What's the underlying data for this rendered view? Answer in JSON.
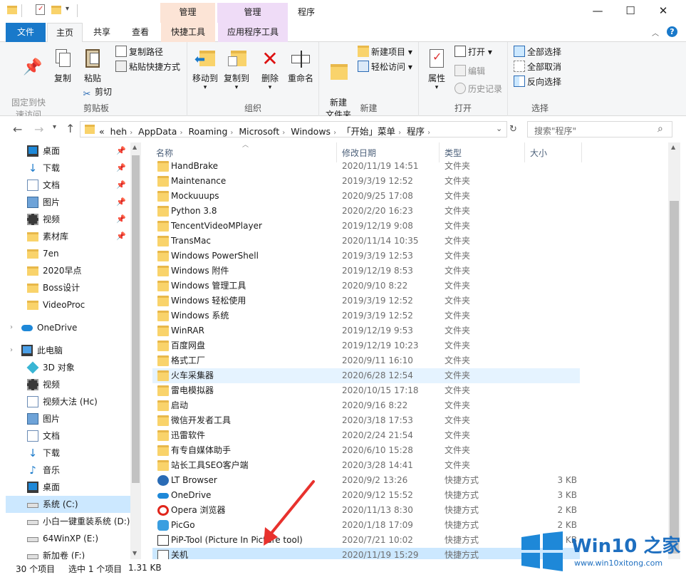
{
  "window": {
    "title": "程序",
    "contextual_tabs": [
      {
        "header": "管理",
        "tab": "快捷工具",
        "color": "#fce4d6"
      },
      {
        "header": "管理",
        "tab": "应用程序工具",
        "color": "#efdcf7"
      }
    ],
    "controls": {
      "minimize": "—",
      "maximize": "☐",
      "close": "✕"
    }
  },
  "tabs": {
    "file": "文件",
    "home": "主页",
    "share": "共享",
    "view": "查看"
  },
  "ribbon": {
    "clipboard": {
      "name": "剪贴板",
      "pin": "固定到快\n速访问",
      "copy": "复制",
      "paste": "粘贴",
      "copy_path": "复制路径",
      "paste_shortcut": "粘贴快捷方式",
      "cut": "剪切"
    },
    "organize": {
      "name": "组织",
      "move_to": "移动到",
      "copy_to": "复制到",
      "delete": "删除",
      "rename": "重命名"
    },
    "new": {
      "name": "新建",
      "new_folder": "新建\n文件夹",
      "new_item": "新建项目",
      "easy_access": "轻松访问"
    },
    "open": {
      "name": "打开",
      "properties": "属性",
      "open": "打开",
      "edit": "编辑",
      "history": "历史记录"
    },
    "select": {
      "name": "选择",
      "select_all": "全部选择",
      "select_none": "全部取消",
      "invert": "反向选择"
    }
  },
  "address": {
    "crumbs": [
      "«",
      "heh",
      "AppData",
      "Roaming",
      "Microsoft",
      "Windows",
      "「开始」菜单",
      "程序"
    ],
    "search_placeholder": "搜索\"程序\""
  },
  "nav": [
    {
      "label": "桌面",
      "icon": "desktop-icon",
      "pinned": true
    },
    {
      "label": "下载",
      "icon": "download-icon",
      "pinned": true
    },
    {
      "label": "文档",
      "icon": "document-icon",
      "pinned": true
    },
    {
      "label": "图片",
      "icon": "picture-icon",
      "pinned": true
    },
    {
      "label": "视频",
      "icon": "video-icon",
      "pinned": true
    },
    {
      "label": "素材库",
      "icon": "folder-icon",
      "pinned": true
    },
    {
      "label": "7en",
      "icon": "folder-icon",
      "pinned": false
    },
    {
      "label": "2020早点",
      "icon": "folder-icon",
      "pinned": false
    },
    {
      "label": "Boss设计",
      "icon": "folder-icon",
      "pinned": false
    },
    {
      "label": "VideoProc",
      "icon": "folder-icon",
      "pinned": false
    },
    {
      "label": "OneDrive",
      "icon": "cloud-icon",
      "pinned": false
    },
    {
      "label": "此电脑",
      "icon": "computer-icon",
      "pinned": false
    },
    {
      "label": "3D 对象",
      "icon": "3d-objects-icon",
      "pinned": false
    },
    {
      "label": "视频",
      "icon": "video-icon",
      "pinned": false
    },
    {
      "label": "视频大法 (Hc)",
      "icon": "document-icon",
      "pinned": false
    },
    {
      "label": "图片",
      "icon": "picture-icon",
      "pinned": false
    },
    {
      "label": "文档",
      "icon": "document-icon",
      "pinned": false
    },
    {
      "label": "下载",
      "icon": "download-icon",
      "pinned": false
    },
    {
      "label": "音乐",
      "icon": "music-icon",
      "pinned": false
    },
    {
      "label": "桌面",
      "icon": "desktop-icon",
      "pinned": false
    },
    {
      "label": "系统 (C:)",
      "icon": "drive-icon",
      "pinned": false
    },
    {
      "label": "小白一键重装系统 (D:)",
      "icon": "drive-icon",
      "pinned": false
    },
    {
      "label": "64WinXP  (E:)",
      "icon": "drive-icon",
      "pinned": false
    },
    {
      "label": "新加卷 (F:)",
      "icon": "drive-icon",
      "pinned": false
    }
  ],
  "columns": {
    "name": "名称",
    "date": "修改日期",
    "type": "类型",
    "size": "大小"
  },
  "files": [
    {
      "name": "HandBrake",
      "date": "2020/11/19 14:51",
      "type": "文件夹",
      "size": "",
      "icon": "folder"
    },
    {
      "name": "Maintenance",
      "date": "2019/3/19 12:52",
      "type": "文件夹",
      "size": "",
      "icon": "folder"
    },
    {
      "name": "Mockuuups",
      "date": "2020/9/25 17:08",
      "type": "文件夹",
      "size": "",
      "icon": "folder"
    },
    {
      "name": "Python 3.8",
      "date": "2020/2/20 16:23",
      "type": "文件夹",
      "size": "",
      "icon": "folder"
    },
    {
      "name": "TencentVideoMPlayer",
      "date": "2019/12/19 9:08",
      "type": "文件夹",
      "size": "",
      "icon": "folder"
    },
    {
      "name": "TransMac",
      "date": "2020/11/14 10:35",
      "type": "文件夹",
      "size": "",
      "icon": "folder"
    },
    {
      "name": "Windows PowerShell",
      "date": "2019/3/19 12:53",
      "type": "文件夹",
      "size": "",
      "icon": "folder"
    },
    {
      "name": "Windows 附件",
      "date": "2019/12/19 8:53",
      "type": "文件夹",
      "size": "",
      "icon": "folder"
    },
    {
      "name": "Windows 管理工具",
      "date": "2020/9/10 8:22",
      "type": "文件夹",
      "size": "",
      "icon": "folder"
    },
    {
      "name": "Windows 轻松使用",
      "date": "2019/3/19 12:52",
      "type": "文件夹",
      "size": "",
      "icon": "folder"
    },
    {
      "name": "Windows 系统",
      "date": "2019/3/19 12:52",
      "type": "文件夹",
      "size": "",
      "icon": "folder"
    },
    {
      "name": "WinRAR",
      "date": "2019/12/19 9:53",
      "type": "文件夹",
      "size": "",
      "icon": "folder"
    },
    {
      "name": "百度网盘",
      "date": "2019/12/19 10:23",
      "type": "文件夹",
      "size": "",
      "icon": "folder"
    },
    {
      "name": "格式工厂",
      "date": "2020/9/11 16:10",
      "type": "文件夹",
      "size": "",
      "icon": "folder"
    },
    {
      "name": "火车采集器",
      "date": "2020/6/28 12:54",
      "type": "文件夹",
      "size": "",
      "icon": "folder",
      "hover": true
    },
    {
      "name": "雷电模拟器",
      "date": "2020/10/15 17:18",
      "type": "文件夹",
      "size": "",
      "icon": "folder"
    },
    {
      "name": "启动",
      "date": "2020/9/16 8:22",
      "type": "文件夹",
      "size": "",
      "icon": "folder"
    },
    {
      "name": "微信开发者工具",
      "date": "2020/3/18 17:53",
      "type": "文件夹",
      "size": "",
      "icon": "folder"
    },
    {
      "name": "迅雷软件",
      "date": "2020/2/24 21:54",
      "type": "文件夹",
      "size": "",
      "icon": "folder"
    },
    {
      "name": "有专自媒体助手",
      "date": "2020/6/10 15:28",
      "type": "文件夹",
      "size": "",
      "icon": "folder"
    },
    {
      "name": "站长工具SEO客户端",
      "date": "2020/3/28 14:41",
      "type": "文件夹",
      "size": "",
      "icon": "folder"
    },
    {
      "name": "LT Browser",
      "date": "2020/9/2 13:26",
      "type": "快捷方式",
      "size": "3 KB",
      "icon": "lt"
    },
    {
      "name": "OneDrive",
      "date": "2020/9/12 15:52",
      "type": "快捷方式",
      "size": "3 KB",
      "icon": "onedrive"
    },
    {
      "name": "Opera 浏览器",
      "date": "2020/11/13 8:30",
      "type": "快捷方式",
      "size": "2 KB",
      "icon": "opera"
    },
    {
      "name": "PicGo",
      "date": "2020/1/18 17:09",
      "type": "快捷方式",
      "size": "2 KB",
      "icon": "picgo"
    },
    {
      "name": "PiP-Tool  (Picture In Picture tool)",
      "date": "2020/7/21 10:02",
      "type": "快捷方式",
      "size": "2 KB",
      "icon": "pip"
    },
    {
      "name": "关机",
      "date": "2020/11/19 15:29",
      "type": "快捷方式",
      "size": "",
      "icon": "shortcut",
      "selected": true
    }
  ],
  "status": {
    "count": "30 个项目",
    "selected": "选中 1 个项目",
    "size": "1.31 KB"
  },
  "watermark": {
    "brand": "Win10 之家",
    "url": "www.win10xitong.com"
  }
}
